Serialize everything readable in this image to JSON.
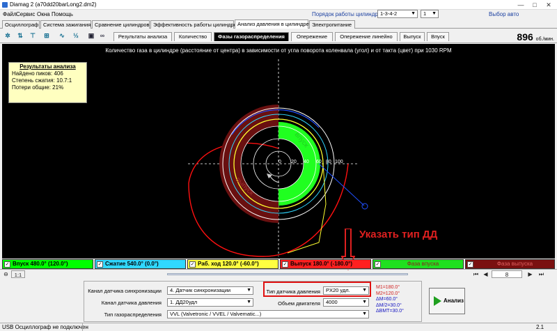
{
  "window": {
    "title": "Diamag 2 (a70dd20barLong2.dm2)"
  },
  "menu": [
    "Файл",
    "Сервис",
    "Окна",
    "Помощь"
  ],
  "top_controls": {
    "firing_order_label": "Порядок работы цилиндров",
    "firing_order_value": "1-3-4-2",
    "cylinder_value": "1",
    "auto_select_label": "Выбор авто"
  },
  "main_tabs": [
    {
      "label": "Осциллограф"
    },
    {
      "label": "Система зажигания"
    },
    {
      "label": "Сравнение цилиндров"
    },
    {
      "label": "Эффективность работы цилиндров"
    },
    {
      "label": "Анализ давления в цилиндре"
    },
    {
      "label": "Электропитание"
    }
  ],
  "toolbar_icons": [
    "settings-icon",
    "compare-icon",
    "scale-icon",
    "graph-icon",
    "fraction-icon",
    "save-icon",
    "glasses-icon"
  ],
  "analysis_tabs": [
    {
      "label": "Результаты анализа"
    },
    {
      "label": "Количество"
    },
    {
      "label": "Фазы газораспределения"
    },
    {
      "label": "Опережение"
    },
    {
      "label": "Опережение линейно"
    },
    {
      "label": "Выпуск"
    },
    {
      "label": "Впуск"
    }
  ],
  "rpm": {
    "value": "896",
    "unit": "об./мин."
  },
  "plot": {
    "title": "Количество газа в цилиндре (расстояние от центра) в зависимости от угла поворота коленвала (угол) и от такта (цвет) при 1030 RPM",
    "axis_ticks": [
      "0",
      "20",
      "40",
      "60",
      "80",
      "100"
    ],
    "intake_label": "впуск",
    "exhaust_label": "выпуск"
  },
  "results": {
    "header": "Результаты анализа",
    "peaks": "Найдено пиков: 406",
    "compression": "Степень сжатия: 10.7:1",
    "losses": "Потери общие: 21%"
  },
  "legend": [
    {
      "label": "Впуск 480.0° (120.0°)",
      "color": "#00ff00",
      "text_color": "#000000"
    },
    {
      "label": "Сжатие 540.0° (0.0°)",
      "color": "#30d8ff",
      "text_color": "#000000"
    },
    {
      "label": "Раб. ход 120.0° (-60.0°)",
      "color": "#ffff40",
      "text_color": "#000000"
    },
    {
      "label": "Выпуск 180.0° (-180.0°)",
      "color": "#ff2020",
      "text_color": "#000000"
    },
    {
      "label": "Фаза впуска",
      "color": "#20e020",
      "text_color": "#8a2020"
    },
    {
      "label": "Фаза выпуска",
      "color": "#7a1010",
      "text_color": "#e06060"
    }
  ],
  "nav": {
    "zoom": "1:1",
    "page": "8"
  },
  "form": {
    "sync_channel_label": "Канал датчика синхронизации",
    "sync_channel_value": "4. Датчик синхронизации",
    "pressure_channel_label": "Канал датчика давления",
    "pressure_channel_value": "1. ДД20удл",
    "timing_type_label": "Тип газораспределения",
    "timing_type_value": "VVL (Valvetronic / VVEL / Valvematic...)",
    "sensor_type_label": "Тип датчика давления",
    "sensor_type_value": "PX20 удл.",
    "engine_volume_label": "Объем двигателя",
    "engine_volume_value": "4000"
  },
  "m_values": [
    {
      "text": "M1=180.0°",
      "color": "#d02020"
    },
    {
      "text": "M2=120.0°",
      "color": "#d02020"
    },
    {
      "text": "ΔM=60.0°",
      "color": "#1010c0"
    },
    {
      "text": "ΔM/2=30.0°",
      "color": "#1010c0"
    },
    {
      "text": "ΔВМТ=30.0°",
      "color": "#1010c0"
    }
  ],
  "analyze_button": "Анализ",
  "annotation": "Указать тип ДД",
  "status": {
    "left": "USB Осциллограф не подключен",
    "right": "2.1"
  }
}
